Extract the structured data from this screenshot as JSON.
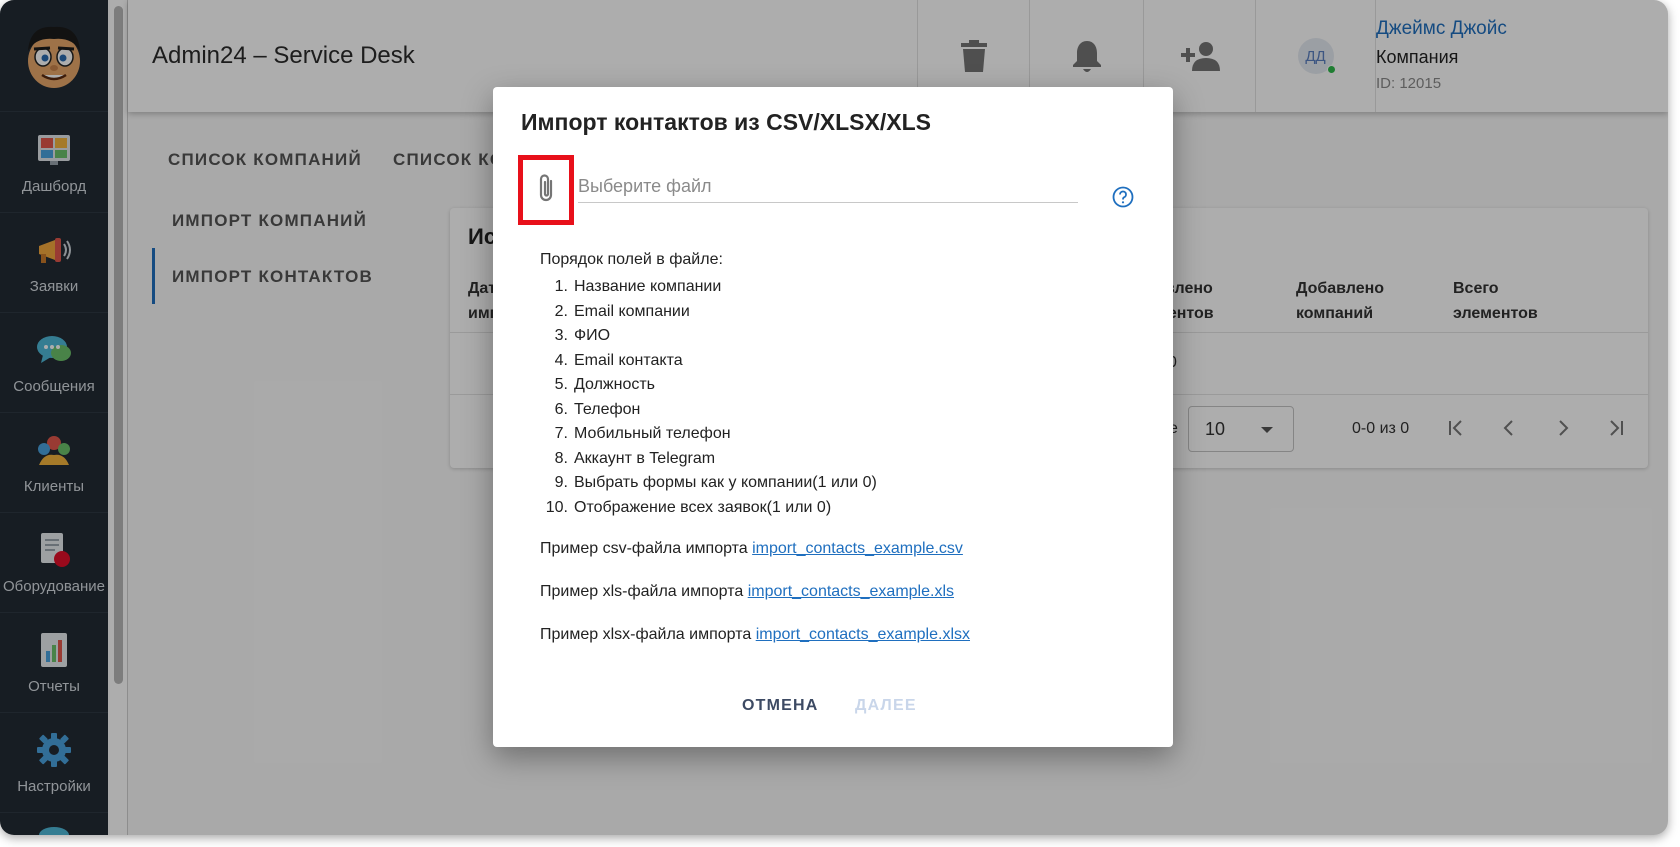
{
  "sidebar": {
    "items": [
      {
        "label": "Дашборд",
        "icon": "dashboard-icon"
      },
      {
        "label": "Заявки",
        "icon": "megaphone-icon"
      },
      {
        "label": "Сообщения",
        "icon": "chat-icon"
      },
      {
        "label": "Клиенты",
        "icon": "clients-icon"
      },
      {
        "label": "Оборудование",
        "icon": "equipment-icon"
      },
      {
        "label": "Отчеты",
        "icon": "reports-icon"
      },
      {
        "label": "Настройки",
        "icon": "gear-icon"
      }
    ]
  },
  "header": {
    "title": "Admin24 – Service Desk",
    "avatar_initials": "ДД",
    "user_name": "Джеймс Джойс",
    "user_company": "Компания",
    "user_id": "ID: 12015"
  },
  "content": {
    "tabs": [
      "СПИСОК КОМПАНИЙ",
      "СПИСОК КО"
    ],
    "subtabs": [
      "ИМПОРТ КОМПАНИЙ",
      "ИМПОРТ КОНТАКТОВ"
    ],
    "card_title_partial": "Ис",
    "columns": [
      {
        "line1": "Дат",
        "line2": "имп"
      },
      {
        "line1": "авлено",
        "line2": "ментов"
      },
      {
        "line1": "Добавлено",
        "line2": "компаний"
      },
      {
        "line1": "Всего",
        "line2": "элементов"
      }
    ],
    "row_partial": "0",
    "rows_per_page_partial": "е",
    "rows_per_page_value": "10",
    "range": "0-0 из 0"
  },
  "dialog": {
    "title": "Импорт контактов из CSV/XLSX/XLS",
    "file_placeholder": "Выберите файл",
    "fields_title": "Порядок полей в файле:",
    "fields": [
      "Название компании",
      "Email компании",
      "ФИО",
      "Email контакта",
      "Должность",
      "Телефон",
      "Мобильный телефон",
      "Аккаунт в Telegram",
      "Выбрать формы как у компании(1 или 0)",
      "Отображение всех заявок(1 или 0)"
    ],
    "examples": [
      {
        "text": "Пример csv-файла импорта ",
        "link": "import_contacts_example.csv"
      },
      {
        "text": "Пример xls-файла импорта ",
        "link": "import_contacts_example.xls"
      },
      {
        "text": "Пример xlsx-файла импорта ",
        "link": "import_contacts_example.xlsx"
      }
    ],
    "cancel_label": "ОТМЕНА",
    "next_label": "ДАЛЕЕ"
  },
  "colors": {
    "sidebar_bg": "#232b34",
    "accent": "#1f6fbf",
    "highlight": "#e8101a"
  }
}
